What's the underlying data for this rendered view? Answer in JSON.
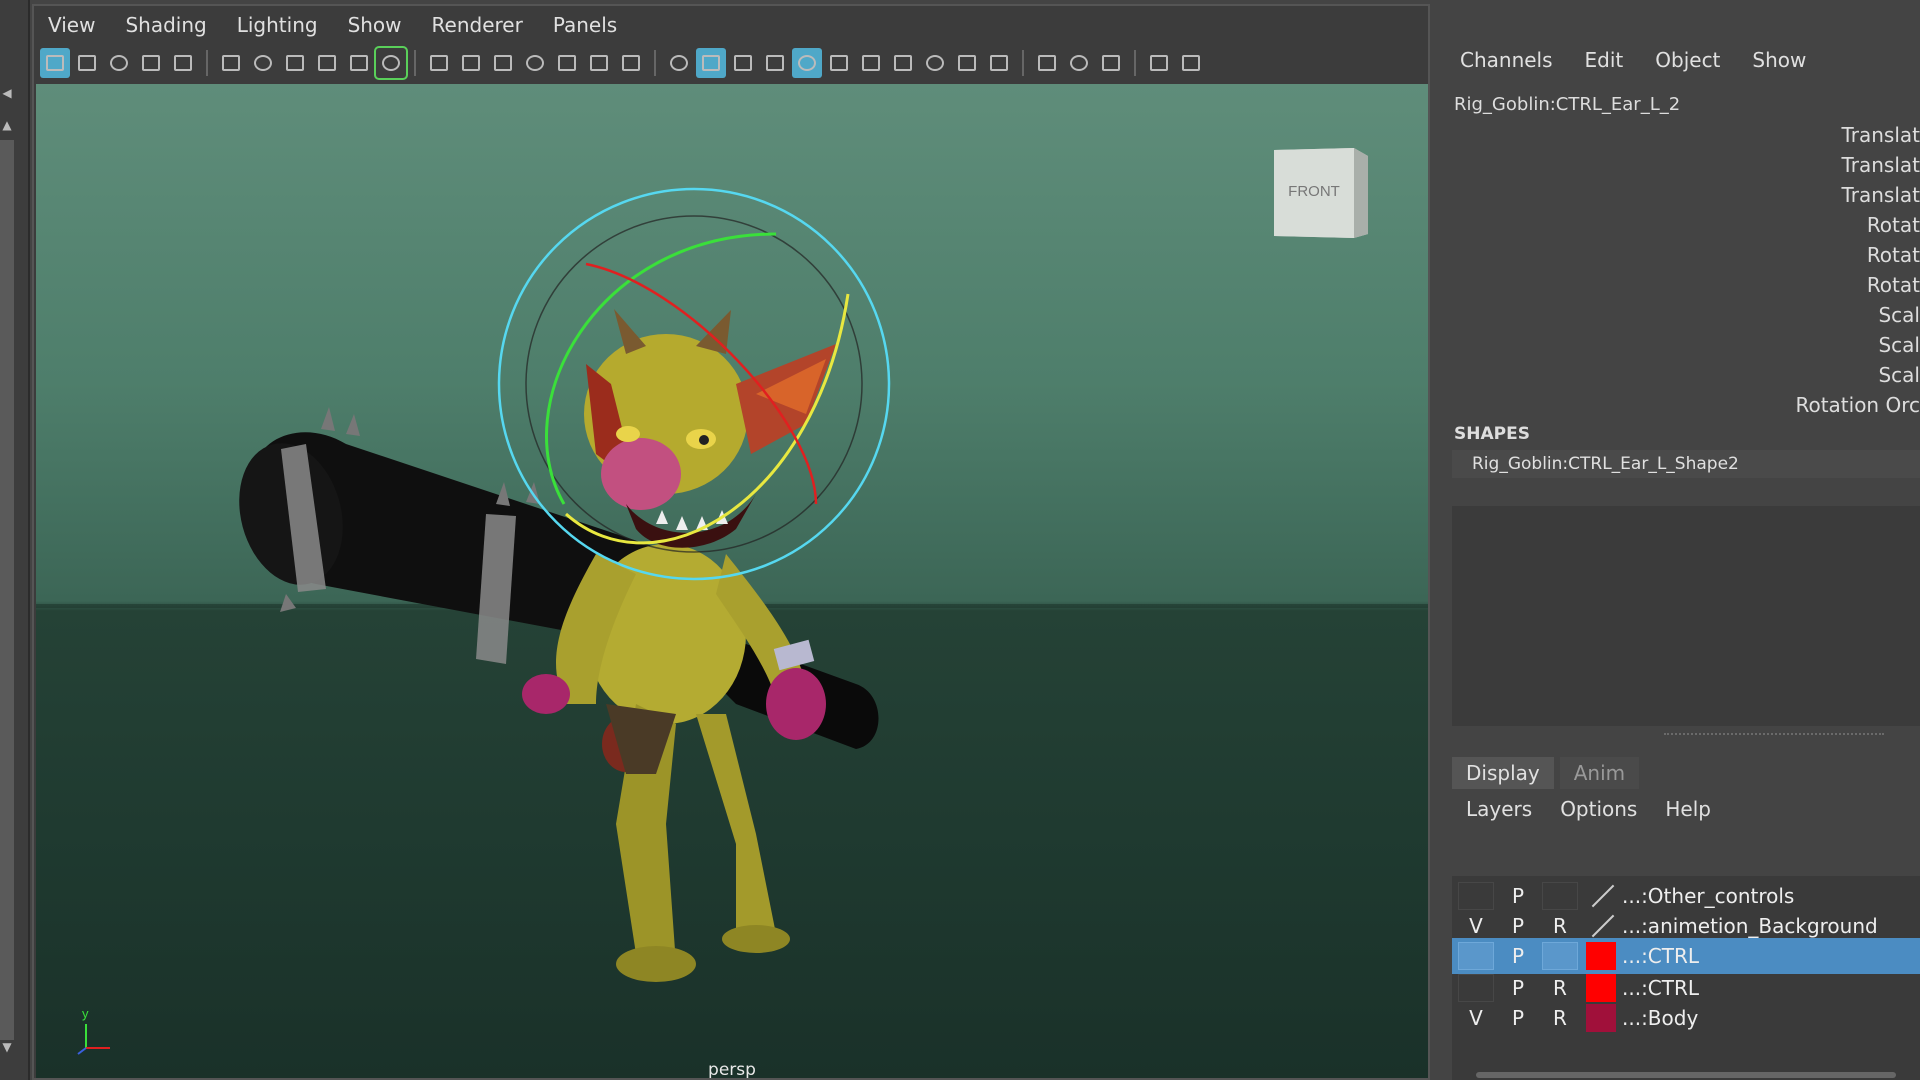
{
  "viewport": {
    "menu": [
      "View",
      "Shading",
      "Lighting",
      "Show",
      "Renderer",
      "Panels"
    ],
    "camera_label": "persp",
    "view_cube_label": "FRONT",
    "axis_y_label": "y"
  },
  "toolbar": {
    "icons": [
      "select-camera-icon",
      "frame-all-icon",
      "frame-selected-icon",
      "lookthrough-icon",
      "bookmark-icon",
      "camera-icon",
      "camera-attr-icon",
      "camera-bookmark-icon",
      "film-gate-icon",
      "image-plane-icon",
      "grease-pencil-icon",
      "grid-icon",
      "film-gate-mask-icon",
      "resolution-gate-icon",
      "gate-mask-icon",
      "field-chart-icon",
      "safe-action-icon",
      "safe-title-icon",
      "wireframe-icon",
      "smooth-shade-icon",
      "default-material-icon",
      "wireframe-on-shaded-icon",
      "xray-icon",
      "lights-icon",
      "shadows-icon",
      "ambient-occlusion-icon",
      "motion-blur-icon",
      "anti-aliasing-icon",
      "depth-of-field-icon",
      "isolate-select-icon",
      "xray-joints-icon",
      "xray-active-icon",
      "hud-icon",
      "viewport-renderer-icon"
    ],
    "active_color": "#4fa8c8",
    "pencil_outline_color": "#5ad05a"
  },
  "channel_box": {
    "menu": [
      "Channels",
      "Edit",
      "Object",
      "Show"
    ],
    "node_name": "Rig_Goblin:CTRL_Ear_L_2",
    "attributes": [
      "Translat",
      "Translat",
      "Translat",
      "Rotat",
      "Rotat",
      "Rotat",
      "Scal",
      "Scal",
      "Scal",
      "Rotation Orc"
    ],
    "shapes_title": "SHAPES",
    "shape_name": "Rig_Goblin:CTRL_Ear_L_Shape2"
  },
  "layer_editor": {
    "tabs": [
      "Display",
      "Anim"
    ],
    "menu": [
      "Layers",
      "Options",
      "Help"
    ],
    "layers": [
      {
        "v": "",
        "p": "P",
        "r": "",
        "color": "none",
        "name": "...:Other_controls",
        "selected": false
      },
      {
        "v": "V",
        "p": "P",
        "r": "R",
        "color": "none",
        "name": "...:animetion_Background",
        "selected": false
      },
      {
        "v": "",
        "p": "P",
        "r": "",
        "color": "#ff0000",
        "name": "...:CTRL",
        "selected": true
      },
      {
        "v": "",
        "p": "P",
        "r": "R",
        "color": "#ff0000",
        "name": "...:CTRL",
        "selected": false
      },
      {
        "v": "V",
        "p": "P",
        "r": "R",
        "color": "#a0103a",
        "name": "...:Body",
        "selected": false
      }
    ],
    "selected_row_color": "#4b8cc2"
  }
}
